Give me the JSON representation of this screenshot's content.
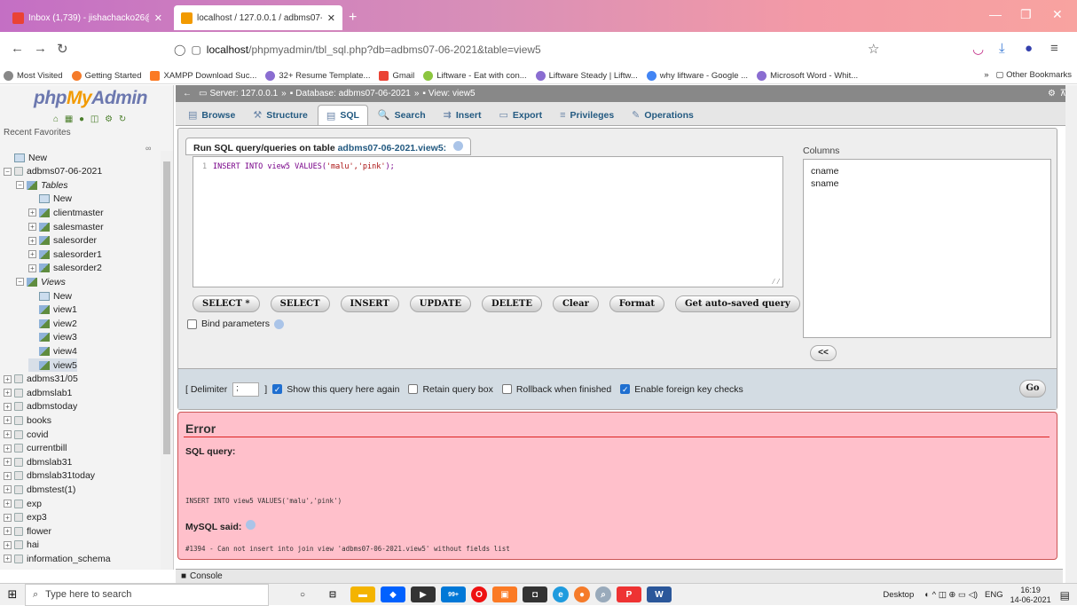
{
  "browser": {
    "tabs": [
      {
        "title": "Inbox (1,739) - jishachacko26@",
        "active": false
      },
      {
        "title": "localhost / 127.0.0.1 / adbms07-",
        "active": true
      }
    ],
    "new_tab": "+",
    "url_host": "localhost",
    "url_path": "/phpmyadmin/tbl_sql.php?db=adbms07-06-2021&table=view5",
    "bookmarks": [
      "Most Visited",
      "Getting Started",
      "XAMPP Download Suc...",
      "32+ Resume Template...",
      "Gmail",
      "Liftware - Eat with con...",
      "Liftware Steady | Liftw...",
      "why liftware - Google ...",
      "Microsoft Word - Whit..."
    ],
    "other_bookmarks": "Other Bookmarks"
  },
  "sidebar": {
    "logo_php": "php",
    "logo_my": "My",
    "logo_admin": "Admin",
    "recent": "Recent",
    "favorites": "Favorites",
    "tree": [
      {
        "label": "New",
        "indent": 0,
        "kind": "new"
      },
      {
        "label": "adbms07-06-2021",
        "indent": 0,
        "kind": "db",
        "exp": "−"
      },
      {
        "label": "Tables",
        "indent": 1,
        "kind": "group",
        "exp": "−"
      },
      {
        "label": "New",
        "indent": 2,
        "kind": "new"
      },
      {
        "label": "clientmaster",
        "indent": 2,
        "kind": "table",
        "exp": "+"
      },
      {
        "label": "salesmaster",
        "indent": 2,
        "kind": "table",
        "exp": "+"
      },
      {
        "label": "salesorder",
        "indent": 2,
        "kind": "table",
        "exp": "+"
      },
      {
        "label": "salesorder1",
        "indent": 2,
        "kind": "table",
        "exp": "+"
      },
      {
        "label": "salesorder2",
        "indent": 2,
        "kind": "table",
        "exp": "+"
      },
      {
        "label": "Views",
        "indent": 1,
        "kind": "group",
        "exp": "−"
      },
      {
        "label": "New",
        "indent": 2,
        "kind": "new"
      },
      {
        "label": "view1",
        "indent": 2,
        "kind": "table"
      },
      {
        "label": "view2",
        "indent": 2,
        "kind": "table"
      },
      {
        "label": "view3",
        "indent": 2,
        "kind": "table"
      },
      {
        "label": "view4",
        "indent": 2,
        "kind": "table"
      },
      {
        "label": "view5",
        "indent": 2,
        "kind": "table",
        "selected": true
      },
      {
        "label": "adbms31/05",
        "indent": 0,
        "kind": "db",
        "exp": "+"
      },
      {
        "label": "adbmslab1",
        "indent": 0,
        "kind": "db",
        "exp": "+"
      },
      {
        "label": "adbmstoday",
        "indent": 0,
        "kind": "db",
        "exp": "+"
      },
      {
        "label": "books",
        "indent": 0,
        "kind": "db",
        "exp": "+"
      },
      {
        "label": "covid",
        "indent": 0,
        "kind": "db",
        "exp": "+"
      },
      {
        "label": "currentbill",
        "indent": 0,
        "kind": "db",
        "exp": "+"
      },
      {
        "label": "dbmslab31",
        "indent": 0,
        "kind": "db",
        "exp": "+"
      },
      {
        "label": "dbmslab31today",
        "indent": 0,
        "kind": "db",
        "exp": "+"
      },
      {
        "label": "dbmstest(1)",
        "indent": 0,
        "kind": "db",
        "exp": "+"
      },
      {
        "label": "exp",
        "indent": 0,
        "kind": "db",
        "exp": "+"
      },
      {
        "label": "exp3",
        "indent": 0,
        "kind": "db",
        "exp": "+"
      },
      {
        "label": "flower",
        "indent": 0,
        "kind": "db",
        "exp": "+"
      },
      {
        "label": "hai",
        "indent": 0,
        "kind": "db",
        "exp": "+"
      },
      {
        "label": "information_schema",
        "indent": 0,
        "kind": "db",
        "exp": "+"
      }
    ]
  },
  "breadcrumb": {
    "server": "Server: 127.0.0.1",
    "database": "Database: adbms07-06-2021",
    "view": "View: view5"
  },
  "tabs": [
    {
      "label": "Browse",
      "icon": "▤"
    },
    {
      "label": "Structure",
      "icon": "⚒"
    },
    {
      "label": "SQL",
      "icon": "▤",
      "active": true
    },
    {
      "label": "Search",
      "icon": "🔍"
    },
    {
      "label": "Insert",
      "icon": "⇉"
    },
    {
      "label": "Export",
      "icon": "▭"
    },
    {
      "label": "Privileges",
      "icon": "≡"
    },
    {
      "label": "Operations",
      "icon": "✎"
    }
  ],
  "query": {
    "title_prefix": "Run SQL query/queries on table",
    "table_name": "adbms07-06-2021.view5:",
    "line_number": "1",
    "code_kw": "INSERT INTO view5 VALUES(",
    "code_str": "'malu','pink'",
    "code_end": ");",
    "buttons": [
      "SELECT *",
      "SELECT",
      "INSERT",
      "UPDATE",
      "DELETE",
      "Clear",
      "Format",
      "Get auto-saved query"
    ],
    "bind_parameters": "Bind parameters",
    "columns_label": "Columns",
    "columns": [
      "cname",
      "sname"
    ],
    "insert_col_button": "<<",
    "delimiter_label": "[ Delimiter",
    "delimiter_value": ";",
    "delimiter_close": "]",
    "options": [
      {
        "label": "Show this query here again",
        "checked": true
      },
      {
        "label": "Retain query box",
        "checked": false
      },
      {
        "label": "Rollback when finished",
        "checked": false
      },
      {
        "label": "Enable foreign key checks",
        "checked": true
      }
    ],
    "go": "Go"
  },
  "error": {
    "title": "Error",
    "sql_query_label": "SQL query:",
    "sql_query": "INSERT INTO view5 VALUES('malu','pink')",
    "mysql_said_label": "MySQL said:",
    "message": "#1394 - Can not insert into join view 'adbms07-06-2021.view5' without fields list"
  },
  "console": "Console",
  "taskbar": {
    "search_placeholder": "Type here to search",
    "desktop": "Desktop",
    "lang": "ENG",
    "time": "16:19",
    "date": "14-06-2021",
    "badge": "99+"
  }
}
